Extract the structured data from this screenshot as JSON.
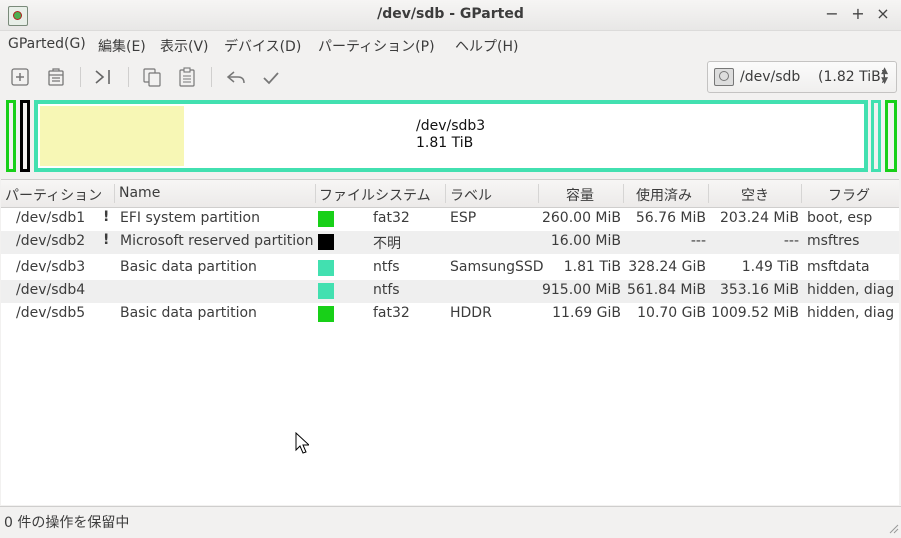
{
  "window": {
    "title": "/dev/sdb - GParted"
  },
  "menu": [
    "GParted(G)",
    "編集(E)",
    "表示(V)",
    "デバイス(D)",
    "パーティション(P)",
    "ヘルプ(H)"
  ],
  "toolbar": {
    "icons": [
      "new-partition-icon",
      "delete-partition-icon",
      "resize-move-icon",
      "copy-icon",
      "paste-icon",
      "undo-icon",
      "apply-icon"
    ]
  },
  "device": {
    "name": "/dev/sdb",
    "size": "(1.82 TiB)"
  },
  "diskmap": {
    "selected_label": "/dev/sdb3",
    "selected_size": "1.81 TiB",
    "colors": {
      "fat32": "#18d018",
      "msr": "#000000",
      "ntfs": "#42e0b0",
      "used": "#f7f7b5"
    }
  },
  "columns": [
    "パーティション",
    "Name",
    "ファイルシステム",
    "ラベル",
    "容量",
    "使用済み",
    "空き",
    "フラグ"
  ],
  "partitions": [
    {
      "part": "/dev/sdb1",
      "warn": "!",
      "name": "EFI system partition",
      "fs_color": "#18d018",
      "fs": "fat32",
      "label": "ESP",
      "size": "260.00 MiB",
      "used": "56.76 MiB",
      "free": "203.24 MiB",
      "flags": "boot, esp"
    },
    {
      "part": "/dev/sdb2",
      "warn": "!",
      "name": "Microsoft reserved partition",
      "fs_color": "#000000",
      "fs": "不明",
      "label": "",
      "size": "16.00 MiB",
      "used": "---",
      "free": "---",
      "flags": "msftres"
    },
    {
      "part": "/dev/sdb3",
      "warn": "",
      "name": "Basic data partition",
      "fs_color": "#42e0b0",
      "fs": "ntfs",
      "label": "SamsungSSD",
      "size": "1.81 TiB",
      "used": "328.24 GiB",
      "free": "1.49 TiB",
      "flags": "msftdata"
    },
    {
      "part": "/dev/sdb4",
      "warn": "",
      "name": "",
      "fs_color": "#42e0b0",
      "fs": "ntfs",
      "label": "",
      "size": "915.00 MiB",
      "used": "561.84 MiB",
      "free": "353.16 MiB",
      "flags": "hidden, diag"
    },
    {
      "part": "/dev/sdb5",
      "warn": "",
      "name": "Basic data partition",
      "fs_color": "#18d018",
      "fs": "fat32",
      "label": "HDDR",
      "size": "11.69 GiB",
      "used": "10.70 GiB",
      "free": "1009.52 MiB",
      "flags": "hidden, diag"
    }
  ],
  "status": "0 件の操作を保留中"
}
